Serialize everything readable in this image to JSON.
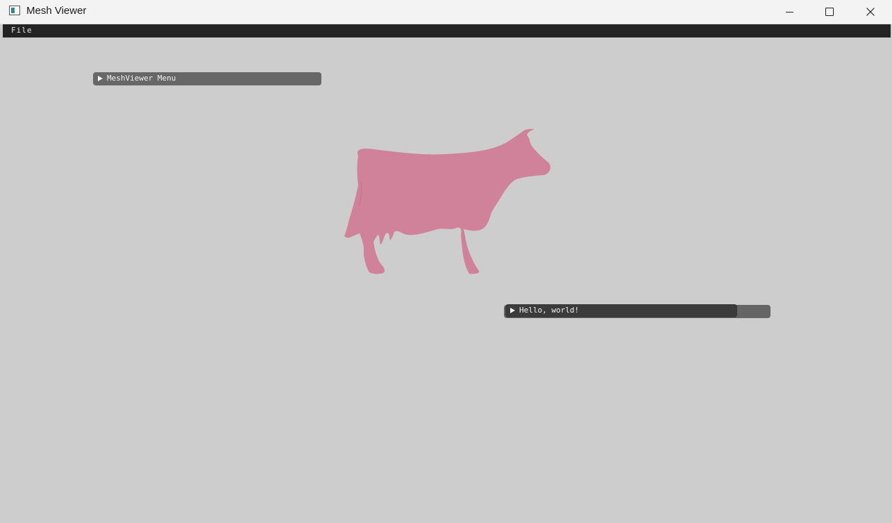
{
  "window": {
    "title": "Mesh Viewer",
    "icon": "app-window-icon"
  },
  "menubar": {
    "items": [
      {
        "label": "File"
      }
    ]
  },
  "viewport": {
    "background_color": "#cdcdcd",
    "mesh_color": "#cf8299",
    "mesh_name": "cow"
  },
  "panels": [
    {
      "label": "MeshViewer Menu",
      "collapsed": true
    },
    {
      "label": "Hello, world!",
      "collapsed": true
    }
  ]
}
